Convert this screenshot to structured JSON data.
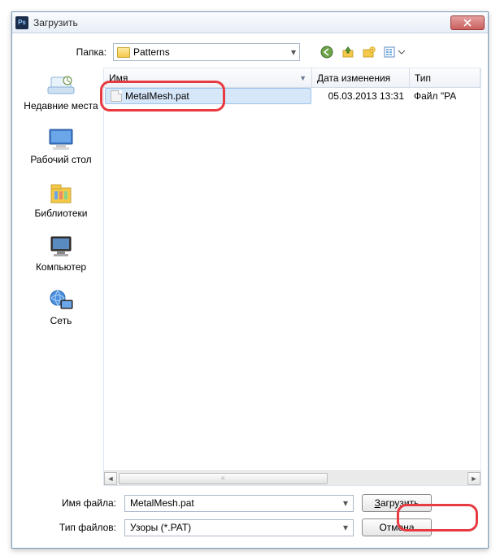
{
  "titlebar": {
    "title": "Загрузить"
  },
  "folderRow": {
    "label": "Папка:",
    "value": "Patterns"
  },
  "columns": {
    "name": "Имя",
    "date": "Дата изменения",
    "type": "Тип"
  },
  "files": [
    {
      "name": "MetalMesh.pat",
      "date": "05.03.2013 13:31",
      "type": "Файл \"PA"
    }
  ],
  "places": {
    "recent": "Недавние места",
    "desktop": "Рабочий стол",
    "libraries": "Библиотеки",
    "computer": "Компьютер",
    "network": "Сеть"
  },
  "bottom": {
    "filenameLabel": "Имя файла:",
    "filenameValue": "MetalMesh.pat",
    "filetypeLabel": "Тип файлов:",
    "filetypeValue": "Узоры (*.PAT)",
    "loadBtnPrefix": "З",
    "loadBtnRest": "агрузить",
    "cancelBtn": "Отмена"
  }
}
